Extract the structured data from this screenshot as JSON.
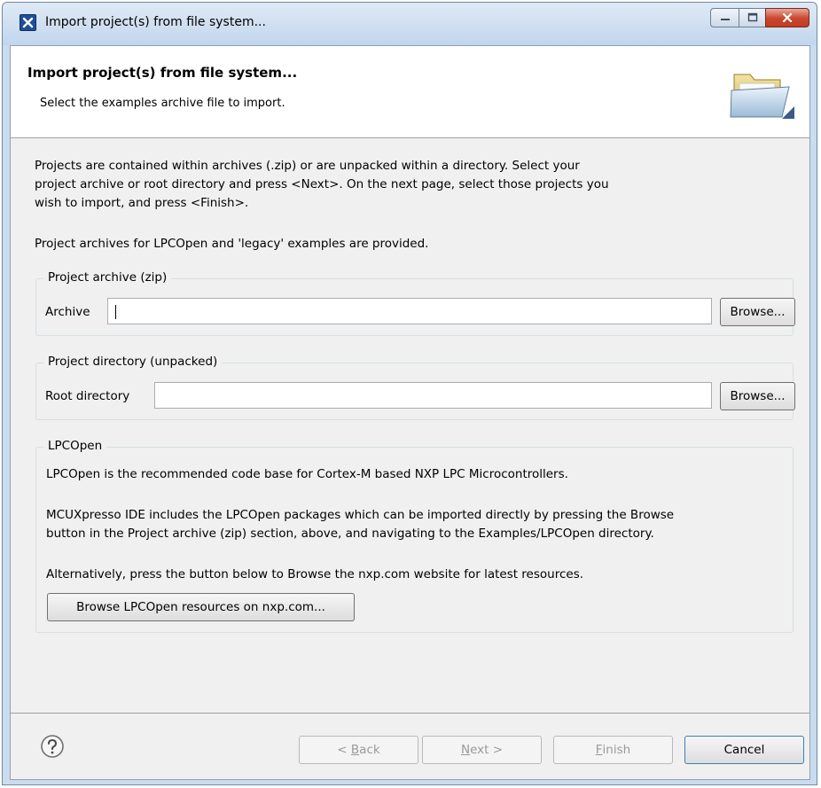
{
  "window": {
    "title": "Import project(s) from file system...",
    "minimize_glyph": "—",
    "maximize_glyph": "□",
    "close_glyph": "✕"
  },
  "header": {
    "title": "Import project(s) from file system...",
    "description": "Select the examples archive file to import.",
    "icon": "folder-open-icon"
  },
  "intro": {
    "lines": [
      "Projects are contained within archives (.zip) or are unpacked within a directory. Select your",
      "project archive or root directory and press <Next>. On the next page, select those projects you",
      "wish to import, and press <Finish>."
    ],
    "note": "Project archives for LPCOpen and 'legacy' examples are provided."
  },
  "archive_group": {
    "title": "Project archive (zip)",
    "field_label": "Archive",
    "value": "",
    "browse_label": "Browse..."
  },
  "directory_group": {
    "title": "Project directory (unpacked)",
    "field_label": "Root directory",
    "value": "",
    "browse_label": "Browse..."
  },
  "lpcopen_group": {
    "title": "LPCOpen",
    "line1": "LPCOpen is the recommended code base for Cortex-M based NXP LPC Microcontrollers.",
    "line2a": "MCUXpresso IDE includes the LPCOpen packages which can be imported directly by pressing the Browse",
    "line2b": "button in the Project archive (zip) section, above, and navigating to the Examples/LPCOpen directory.",
    "line3": "Alternatively, press the button below to Browse the nxp.com website for latest resources.",
    "button_label": "Browse LPCOpen resources on nxp.com..."
  },
  "footer": {
    "help_icon": "help-icon",
    "back": {
      "prefix": "< ",
      "mnemonic": "B",
      "rest": "ack"
    },
    "next": {
      "mnemonic": "N",
      "rest": "ext >"
    },
    "finish": {
      "mnemonic": "F",
      "rest": "inish"
    },
    "cancel": "Cancel"
  },
  "colors": {
    "title_bar": "#cbdcee",
    "dialog_bg": "#f0f0f0",
    "close_button": "#c9462d"
  }
}
